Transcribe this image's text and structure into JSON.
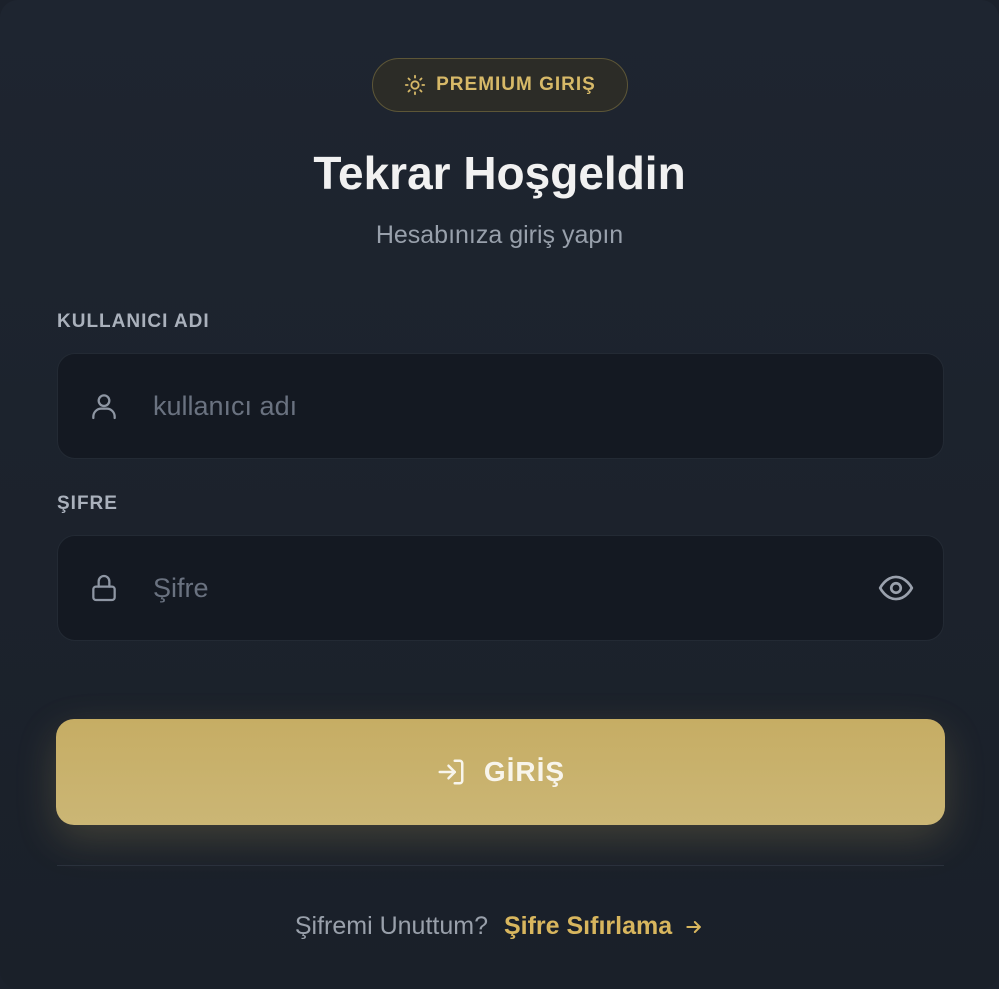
{
  "badge": {
    "icon": "sun-icon",
    "label": "PREMIUM GIRIŞ"
  },
  "heading": {
    "title": "Tekrar Hoşgeldin",
    "subtitle": "Hesabınıza giriş yapın"
  },
  "username": {
    "label": "KULLANICI ADI",
    "placeholder": "kullanıcı adı",
    "value": "",
    "icon": "user-icon"
  },
  "password": {
    "label": "ŞIFRE",
    "placeholder": "Şifre",
    "value": "",
    "icon": "lock-icon",
    "toggle_icon": "eye-icon"
  },
  "submit": {
    "label": "GİRİŞ",
    "icon": "login-icon"
  },
  "footer": {
    "question": "Şifremi Unuttum?",
    "link_label": "Şifre Sıfırlama",
    "link_icon": "arrow-right-icon"
  },
  "colors": {
    "accent": "#c8b06a",
    "background": "#1d232d",
    "input_bg": "#141922"
  }
}
